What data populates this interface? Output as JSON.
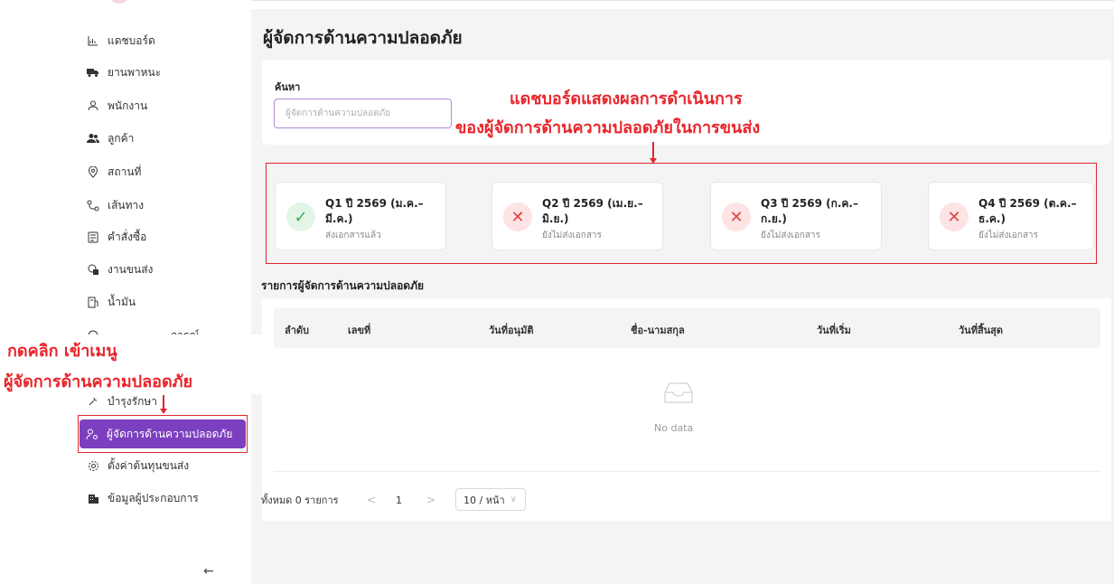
{
  "sidebar": {
    "items": [
      {
        "label": "แดชบอร์ด",
        "icon": "bar-chart-icon"
      },
      {
        "label": "ยานพาหนะ",
        "icon": "truck-icon"
      },
      {
        "label": "พนักงาน",
        "icon": "user-icon"
      },
      {
        "label": "ลูกค้า",
        "icon": "users-icon"
      },
      {
        "label": "สถานที่",
        "icon": "location-pin-icon"
      },
      {
        "label": "เส้นทาง",
        "icon": "route-icon"
      },
      {
        "label": "คำสั่งซื้อ",
        "icon": "order-icon"
      },
      {
        "label": "งานขนส่ง",
        "icon": "box-icon"
      },
      {
        "label": "น้ำมัน",
        "icon": "fuel-icon"
      },
      {
        "label": "การณ์",
        "icon": "incident-icon"
      },
      {
        "label": "บำรุงรักษา",
        "icon": "wrench-icon"
      },
      {
        "label": "ผู้จัดการด้านความปลอดภัย",
        "icon": "safety-manager-icon"
      },
      {
        "label": "ตั้งค่าต้นทุนขนส่ง",
        "icon": "settings-icon"
      },
      {
        "label": "ข้อมูลผู้ประกอบการ",
        "icon": "building-icon"
      }
    ],
    "collapse_icon": "←"
  },
  "header": {
    "title": "ผู้จัดการด้านความปลอดภัย"
  },
  "search": {
    "label": "ค้นหา",
    "placeholder": "ผู้จัดการด้านความปลอดภัย"
  },
  "quarters": [
    {
      "title": "Q1 ปี 2569 (ม.ค.–มี.ค.)",
      "status": "ส่งเอกสารแล้ว",
      "state": "submitted",
      "icon": "check-icon",
      "glyph": "✓"
    },
    {
      "title": "Q2 ปี 2569 (เม.ย.–มิ.ย.)",
      "status": "ยังไม่ส่งเอกสาร",
      "state": "pending",
      "icon": "cross-icon",
      "glyph": "✕"
    },
    {
      "title": "Q3 ปี 2569 (ก.ค.–ก.ย.)",
      "status": "ยังไม่ส่งเอกสาร",
      "state": "pending",
      "icon": "cross-icon",
      "glyph": "✕"
    },
    {
      "title": "Q4 ปี 2569 (ต.ค.–ธ.ค.)",
      "status": "ยังไม่ส่งเอกสาร",
      "state": "pending",
      "icon": "cross-icon",
      "glyph": "✕"
    }
  ],
  "list": {
    "title": "รายการผู้จัดการด้านความปลอดภัย",
    "columns": [
      "ลำดับ",
      "เลขที่",
      "วันที่อนุมัติ",
      "ชื่อ-นามสกุล",
      "วันที่เริ่ม",
      "วันที่สิ้นสุด"
    ],
    "empty_text": "No data"
  },
  "pagination": {
    "total": "ทั้งหมด 0 รายการ",
    "prev": "<",
    "page": "1",
    "next": ">",
    "page_size": "10 / หน้า"
  },
  "annotations": {
    "dashboard_line1": "แดชบอร์ดแสดงผลการดำเนินการ",
    "dashboard_line2": "ของผู้จัดการด้านความปลอดภัยในการขนส่ง",
    "menu_line1": "กดคลิก เข้าเมนู",
    "menu_line2": "ผู้จัดการด้านความปลอดภัย"
  },
  "colors": {
    "accent": "#7b3fbf",
    "annotation": "#e8252b",
    "success": "#3fb05a",
    "danger": "#e04545"
  }
}
